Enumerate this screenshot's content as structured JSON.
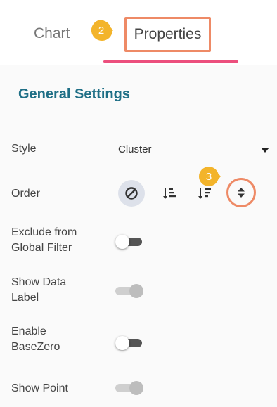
{
  "tabs": {
    "chart_label": "Chart",
    "properties_label": "Properties"
  },
  "badges": {
    "step_2": "2",
    "step_3": "3",
    "color": "#f3b42b",
    "highlight_color": "#ee8a66"
  },
  "section": {
    "title": "General Settings"
  },
  "settings": {
    "style_label": "Style",
    "style_value": "Cluster",
    "order_label": "Order",
    "order_options": [
      "none-icon",
      "sort-ascending-icon",
      "sort-descending-icon",
      "sort-toggle-icon"
    ],
    "exclude_label_1": "Exclude from",
    "exclude_label_2": "Global Filter",
    "show_data_label_1": "Show Data",
    "show_data_label_2": "Label",
    "enable_basezero_1": "Enable",
    "enable_basezero_2": "BaseZero",
    "show_point_label": "Show Point"
  },
  "toggles": {
    "exclude_global_filter": "off",
    "show_data_label": "on",
    "enable_basezero": "off",
    "show_point": "on"
  },
  "colors": {
    "accent_underline": "#ec4f7d",
    "section_title": "#1f6f86"
  }
}
